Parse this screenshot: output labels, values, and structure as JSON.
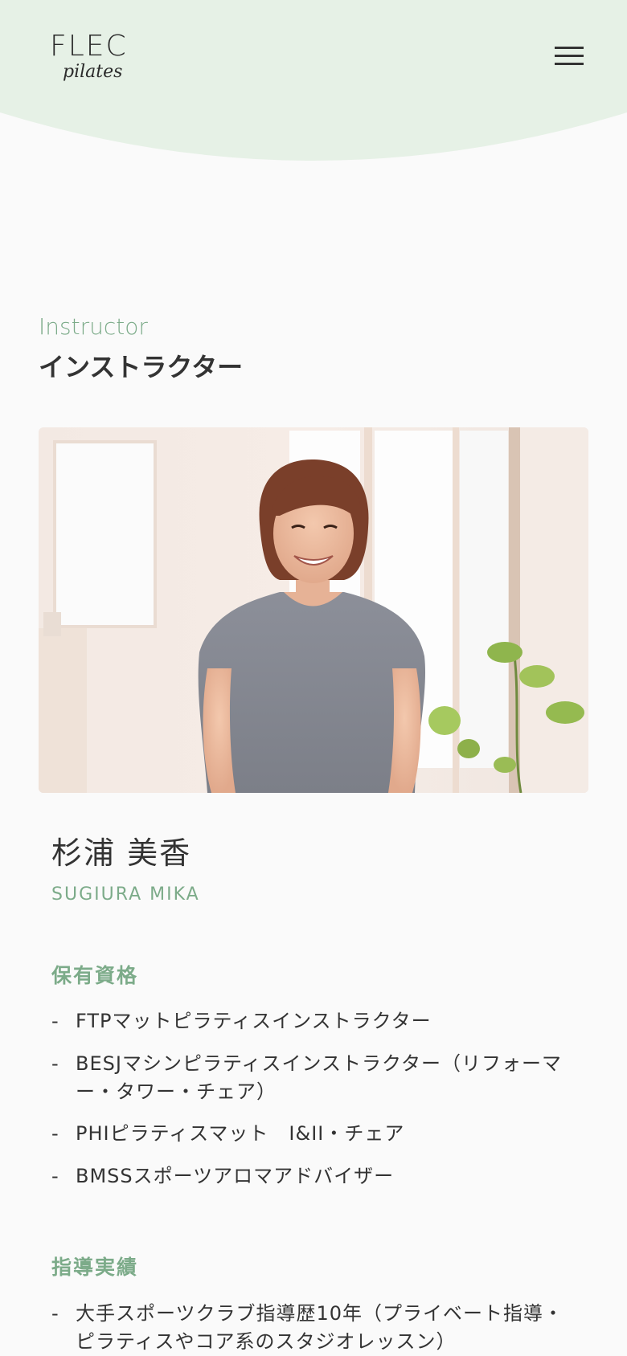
{
  "brand": {
    "logo_main": "FLEC",
    "logo_sub": "pilates",
    "header_color": "#e6f1e6",
    "accent": "#7cab89"
  },
  "header": {
    "menu_icon": "hamburger-menu-icon"
  },
  "section": {
    "title_en": "Instructor",
    "title_jp": "インストラクター"
  },
  "instructor": {
    "photo_desc_icon": "instructor-photo",
    "name_jp": "杉浦 美香",
    "name_en": "SUGIURA MIKA",
    "qualifications_title": "保有資格",
    "qualifications": [
      "FTPマットピラティスインストラクター",
      "BESJマシンピラティスインストラクター（リフォーマー・タワー・チェア）",
      "PHIピラティスマット　I&II・チェア",
      "BMSSスポーツアロマアドバイザー"
    ],
    "experience_title": "指導実績",
    "experience": [
      "大手スポーツクラブ指導歴10年（プライベート指導・ピラティスやコア系のスタジオレッスン）"
    ],
    "bullet": "-"
  }
}
